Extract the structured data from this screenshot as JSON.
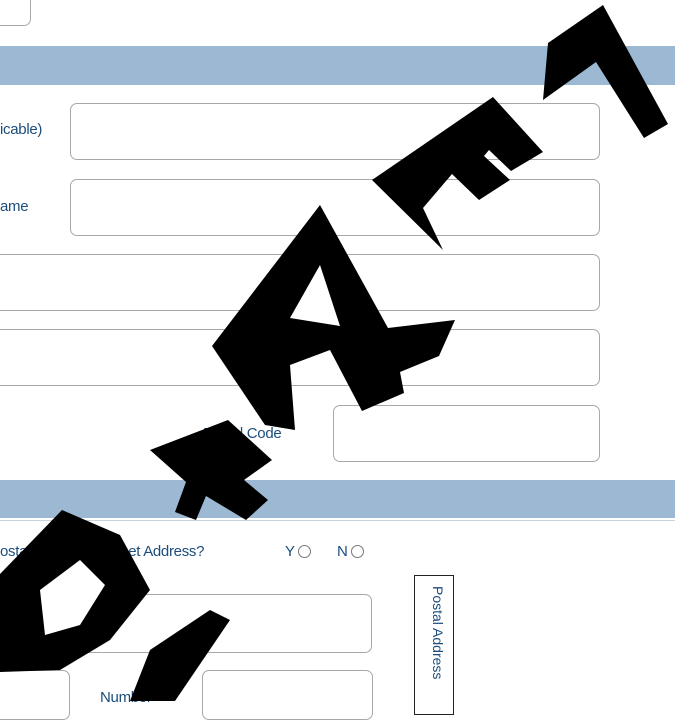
{
  "section1": {
    "field1_label": "icable)",
    "field2_label": "ame",
    "postal_code_label": "Postal Code"
  },
  "section2": {
    "question": "ostal Address a Street Address?",
    "yes_label": "Y",
    "no_label": "N",
    "number_label": "Number",
    "side_tab_label": "Postal Address"
  },
  "watermark": {
    "text": "DRAFT",
    "color": "#000000"
  },
  "colors": {
    "section_bar": "#9db8d2",
    "label_text": "#1c4d7c"
  }
}
